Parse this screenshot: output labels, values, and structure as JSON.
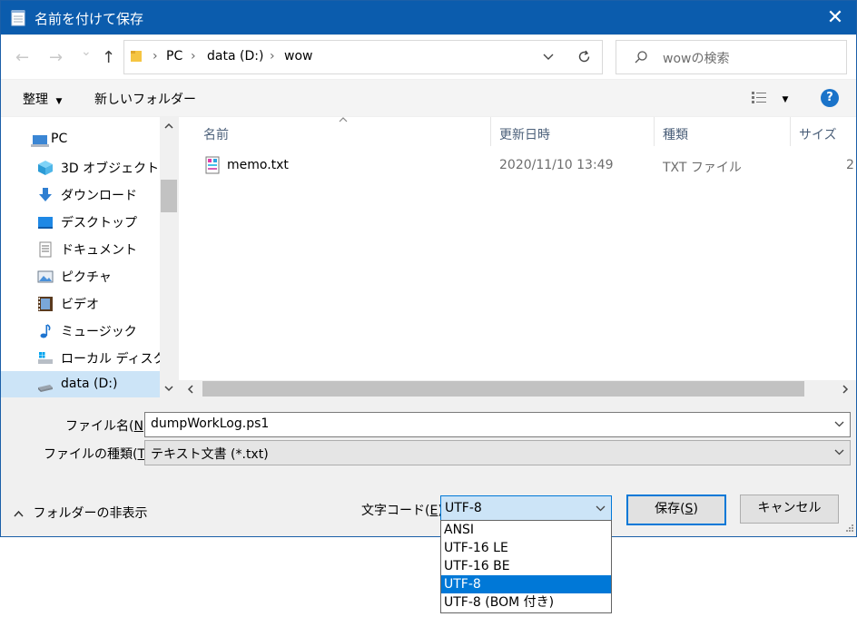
{
  "window": {
    "title": "名前を付けて保存",
    "close_glyph": "✕"
  },
  "nav": {
    "back_glyph": "←",
    "forward_glyph": "→",
    "recent_glyph": "⌄",
    "up_glyph": "↑",
    "breadcrumb": [
      "PC",
      "data (D:)",
      "wow"
    ],
    "breadcrumb_sep": "›",
    "search_placeholder": "wowの検索"
  },
  "toolbar": {
    "organize_label": "整理",
    "new_folder_label": "新しいフォルダー",
    "help_glyph": "?"
  },
  "sidebar": {
    "items": [
      {
        "label": "PC",
        "icon": "pc-icon"
      },
      {
        "label": "3D オブジェクト",
        "icon": "3d-objects-icon"
      },
      {
        "label": "ダウンロード",
        "icon": "download-icon"
      },
      {
        "label": "デスクトップ",
        "icon": "desktop-icon"
      },
      {
        "label": "ドキュメント",
        "icon": "documents-icon"
      },
      {
        "label": "ピクチャ",
        "icon": "pictures-icon"
      },
      {
        "label": "ビデオ",
        "icon": "videos-icon"
      },
      {
        "label": "ミュージック",
        "icon": "music-icon"
      },
      {
        "label": "ローカル ディスク (C",
        "icon": "local-disk-icon"
      },
      {
        "label": "data (D:)",
        "icon": "drive-icon"
      }
    ]
  },
  "files": {
    "columns": [
      "名前",
      "更新日時",
      "種類",
      "サイズ"
    ],
    "rows": [
      {
        "name": "memo.txt",
        "modified": "2020/11/10 13:49",
        "type": "TXT ファイル",
        "size": "2"
      }
    ]
  },
  "form": {
    "filename_label_pre": "ファイル名(",
    "filename_label_key": "N",
    "filename_label_post": "):",
    "filename_value": "dumpWorkLog.ps1",
    "filetype_label_pre": "ファイルの種類(",
    "filetype_label_key": "T",
    "filetype_label_post": "):",
    "filetype_value": "テキスト文書 (*.txt)",
    "hide_folders_label": "フォルダーの非表示",
    "encoding_label_pre": "文字コード(",
    "encoding_label_key": "E",
    "encoding_label_post": "):",
    "encoding_value": "UTF-8",
    "save_label_pre": "保存(",
    "save_label_key": "S",
    "save_label_post": ")",
    "cancel_label": "キャンセル",
    "encoding_options": [
      "ANSI",
      "UTF-16 LE",
      "UTF-16 BE",
      "UTF-8",
      "UTF-8 (BOM 付き)"
    ],
    "encoding_selected_index": 3
  },
  "colors": {
    "titlebar": "#0b5cad",
    "selection": "#0078d7",
    "help": "#1a73c9"
  }
}
